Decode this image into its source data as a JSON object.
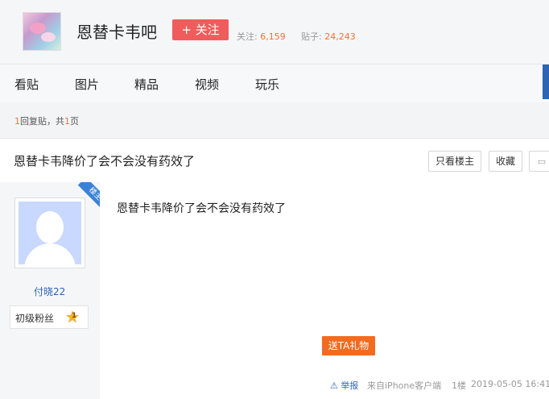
{
  "header": {
    "forum_name": "恩替卡韦吧",
    "follow_label": "+ 关注",
    "follows_label": "关注:",
    "follows_value": "6,159",
    "posts_label": "贴子:",
    "posts_value": "24,243"
  },
  "nav": {
    "tabs": [
      "看贴",
      "图片",
      "精品",
      "视频",
      "玩乐"
    ]
  },
  "pager": {
    "count": "1",
    "reply_text": "回复贴，共",
    "pages": "1",
    "page_unit": "页"
  },
  "thread": {
    "title": "恩替卡韦降价了会不会没有药效了",
    "only_op_label": "只看楼主",
    "collect_label": "收藏"
  },
  "post": {
    "badge": "楼主",
    "author": "付晓22",
    "level_label": "初级粉丝",
    "level_num": "1",
    "body": "恩替卡韦降价了会不会没有药效了",
    "gift_label": "送TA礼物",
    "report_label": "举报",
    "source": "来自iPhone客户端",
    "floor": "1楼",
    "time": "2019-05-05 16:41"
  },
  "colors": {
    "follow_button": "#f05c5c",
    "gift_button": "#f26b1f",
    "link_blue": "#2d64b3",
    "highlight_orange": "#e7743a"
  }
}
